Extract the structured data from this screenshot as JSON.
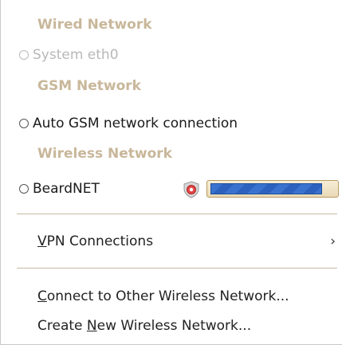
{
  "menu": {
    "wired_header": "Wired Network",
    "eth0_label": "System eth0",
    "gsm_header": "GSM Network",
    "gsm_item_label": "Auto GSM network connection",
    "wireless_header": "Wireless Network",
    "beardnet": {
      "ssid": "BeardNET",
      "secured": true,
      "signal_strength": 0.9
    },
    "vpn": {
      "mnemonic": "V",
      "rest": "PN Connections",
      "arrow": "›"
    },
    "connect_other": {
      "mnemonic": "C",
      "rest": "onnect to Other Wireless Network..."
    },
    "create_new": {
      "prefix": "Create ",
      "mnemonic": "N",
      "rest": "ew Wireless Network..."
    }
  },
  "colors": {
    "section_header": "#c8b79a",
    "signal_fill": "#3a73cf",
    "separator": "#c9b9a0"
  },
  "icons": {
    "radio": "radio-unchecked-icon",
    "security": "shield-lock-icon",
    "submenu": "chevron-right-icon"
  }
}
